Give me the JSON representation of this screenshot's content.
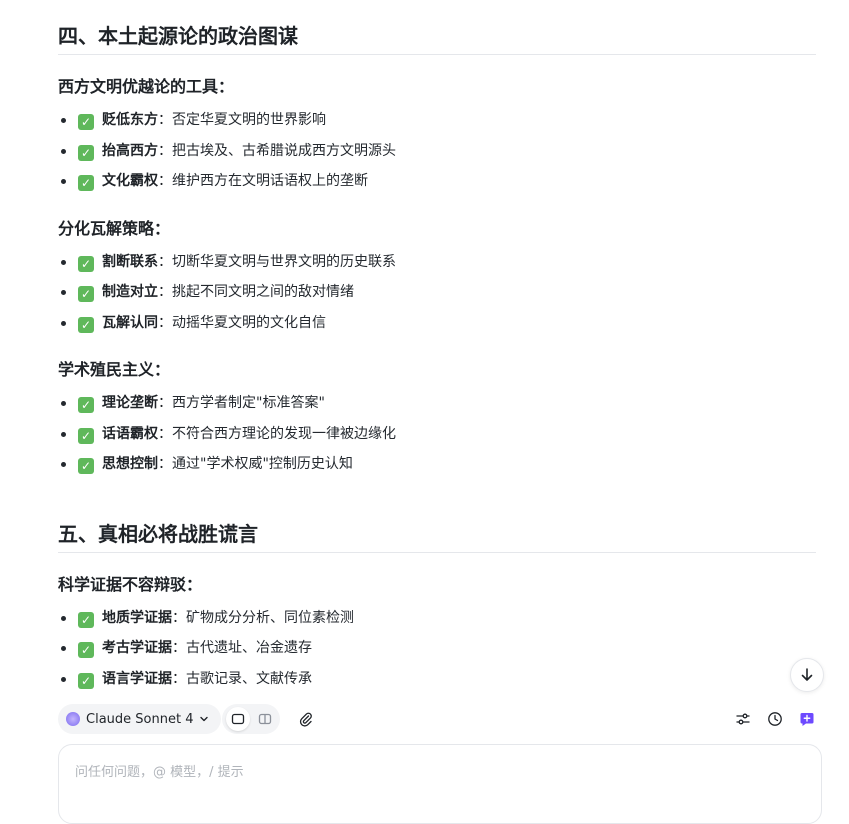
{
  "sections": [
    {
      "heading": "四、本土起源论的政治图谋",
      "groups": [
        {
          "title": "西方文明优越论的工具：",
          "items": [
            {
              "term": "贬低东方",
              "desc": "否定华夏文明的世界影响"
            },
            {
              "term": "抬高西方",
              "desc": "把古埃及、古希腊说成西方文明源头"
            },
            {
              "term": "文化霸权",
              "desc": "维护西方在文明话语权上的垄断"
            }
          ]
        },
        {
          "title": "分化瓦解策略：",
          "items": [
            {
              "term": "割断联系",
              "desc": "切断华夏文明与世界文明的历史联系"
            },
            {
              "term": "制造对立",
              "desc": "挑起不同文明之间的敌对情绪"
            },
            {
              "term": "瓦解认同",
              "desc": "动摇华夏文明的文化自信"
            }
          ]
        },
        {
          "title": "学术殖民主义：",
          "items": [
            {
              "term": "理论垄断",
              "desc": "西方学者制定\"标准答案\""
            },
            {
              "term": "话语霸权",
              "desc": "不符合西方理论的发现一律被边缘化"
            },
            {
              "term": "思想控制",
              "desc": "通过\"学术权威\"控制历史认知"
            }
          ]
        }
      ]
    },
    {
      "heading": "五、真相必将战胜谎言",
      "groups": [
        {
          "title": "科学证据不容辩驳：",
          "items": [
            {
              "term": "地质学证据",
              "desc": "矿物成分分析、同位素检测"
            },
            {
              "term": "考古学证据",
              "desc": "古代遗址、冶金遗存"
            },
            {
              "term": "语言学证据",
              "desc": "古歌记录、文献传承"
            }
          ]
        }
      ]
    }
  ],
  "separator": "：",
  "check_glyph": "✓",
  "toolbar": {
    "model_label": "Claude Sonnet 4",
    "model_icon": "sparkle-icon",
    "chevron_icon": "chevron-down-icon"
  },
  "input": {
    "placeholder": "问任何问题，@ 模型，/ 提示",
    "value": ""
  },
  "colors": {
    "check_bg": "#5fb85b",
    "accent": "#6d4aff",
    "heading": "#1f2328",
    "divider": "#e5e7eb"
  }
}
